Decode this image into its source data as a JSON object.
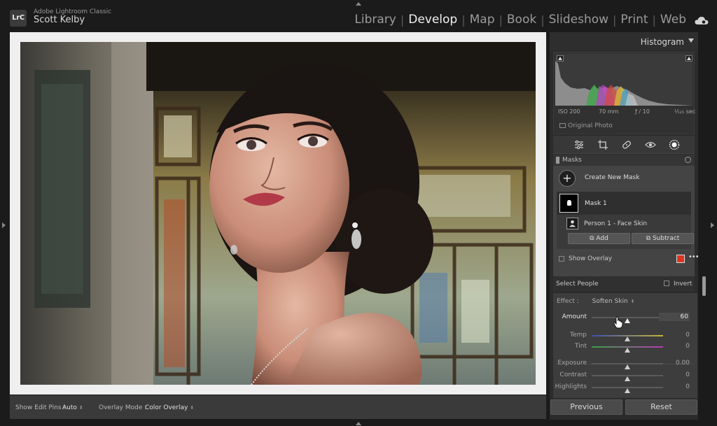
{
  "app": {
    "logo": "LrC",
    "title": "Adobe Lightroom Classic",
    "user": "Scott Kelby"
  },
  "modules": [
    {
      "label": "Library",
      "active": false
    },
    {
      "label": "Develop",
      "active": true
    },
    {
      "label": "Map",
      "active": false
    },
    {
      "label": "Book",
      "active": false
    },
    {
      "label": "Slideshow",
      "active": false
    },
    {
      "label": "Print",
      "active": false
    },
    {
      "label": "Web",
      "active": false
    }
  ],
  "toolbar": {
    "edit_pins_label": "Show Edit Pins :",
    "edit_pins_value": "Auto",
    "overlay_mode_label": "Overlay Mode :",
    "overlay_mode_value": "Color Overlay"
  },
  "histogram": {
    "title": "Histogram",
    "iso": "ISO 200",
    "focal": "70 mm",
    "aperture": "ƒ / 10",
    "shutter": "¹⁄₁₂₅ sec",
    "original_photo": "Original Photo"
  },
  "tools": [
    "sliders-icon",
    "crop-icon",
    "heal-icon",
    "redeye-icon",
    "mask-icon"
  ],
  "masks": {
    "header": "Masks",
    "create_new": "Create New Mask",
    "mask_name": "Mask 1",
    "submask_name": "Person 1 - Face Skin",
    "add_label": "Add",
    "subtract_label": "Subtract",
    "show_overlay": "Show Overlay",
    "overlay_color": "#d9351f"
  },
  "select_people": {
    "label": "Select People",
    "invert": "Invert"
  },
  "effect": {
    "label": "Effect :",
    "value": "Soften Skin"
  },
  "sliders": [
    {
      "label": "Amount",
      "value": "60",
      "pos": 0.5
    },
    {
      "label": "Temp",
      "value": "0",
      "pos": 0.5
    },
    {
      "label": "Tint",
      "value": "0",
      "pos": 0.5
    },
    {
      "label": "Exposure",
      "value": "0.00",
      "pos": 0.5
    },
    {
      "label": "Contrast",
      "value": "0",
      "pos": 0.5
    },
    {
      "label": "Highlights",
      "value": "0",
      "pos": 0.5
    }
  ],
  "footer": {
    "previous": "Previous",
    "reset": "Reset"
  }
}
